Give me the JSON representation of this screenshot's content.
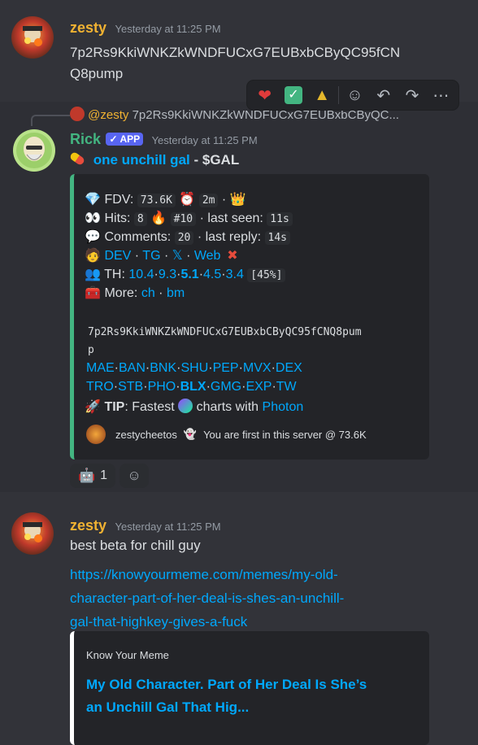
{
  "msg1": {
    "author": "zesty",
    "timestamp": "Yesterday at 11:25 PM",
    "text_line1": "7p2Rs9KkiWNKZkWNDFUCxG7EUBxbCByQC95fCN",
    "text_line2": "Q8pump"
  },
  "reply": {
    "author": "@zesty",
    "preview": "7p2Rs9KkiWNKZkWNDFUCxG7EUBxbCByQC..."
  },
  "msg2": {
    "author": "Rick",
    "badge": "APP",
    "timestamp": "Yesterday at 11:25 PM",
    "title_link": "one unchill gal",
    "title_sep": " - ",
    "title_ticker": "$GAL",
    "embed": {
      "fdv_label": "FDV:",
      "fdv_value": "73.6K",
      "age_value": "2m",
      "hits_label": "Hits:",
      "hits_value": "8",
      "rank": "#10",
      "last_seen_label": "· last seen:",
      "last_seen_value": "11s",
      "comments_label": "Comments:",
      "comments_value": "20",
      "last_reply_label": "· last reply:",
      "last_reply_value": "14s",
      "links": [
        "DEV",
        "TG",
        "𝕏",
        "Web"
      ],
      "th_label": "TH:",
      "th_values": [
        "10.4",
        "9.3",
        "5.1",
        "4.5",
        "3.4"
      ],
      "th_pct": "[45%]",
      "more_label": "More:",
      "more_links": [
        "ch",
        "bm"
      ],
      "address_line1": "7p2Rs9KkiWNKZkWNDFUCxG7EUBxbCByQC95fCNQ8pum",
      "address_line2": "p",
      "platforms_row1": [
        "MAE",
        "BAN",
        "BNK",
        "SHU",
        "PEP",
        "MVX",
        "DEX"
      ],
      "platforms_row2": [
        "TRO",
        "STB",
        "PHO",
        "BLX",
        "GMG",
        "EXP",
        "TW"
      ],
      "tip_label": "TIP",
      "tip_text1": ": Fastest",
      "tip_text2": "charts with",
      "tip_link": "Photon",
      "footer_user": "zestycheetos",
      "footer_text": "You are first in this server @ 73.6K"
    },
    "reaction_count": "1"
  },
  "msg3": {
    "author": "zesty",
    "timestamp": "Yesterday at 11:25 PM",
    "text": "best beta for chill guy",
    "url_line1": "https://knowyourmeme.com/memes/my-old-",
    "url_line2": "character-part-of-her-deal-is-shes-an-unchill-",
    "url_line3": "gal-that-highkey-gives-a-fuck",
    "embed_provider": "Know Your Meme",
    "embed_title_line1": "My Old Character. Part of Her Deal Is She’s",
    "embed_title_line2": "an Unchill Gal That Hig..."
  },
  "colors": {
    "background": "#323339",
    "hover_bg": "#2e2f35",
    "username_zesty": "#f0b232",
    "username_rick": "#43b581",
    "link": "#00a8fc",
    "embed_border": "#43b581",
    "app_badge": "#5865f2"
  },
  "icons": [
    "heart-icon",
    "check-icon",
    "arrow-logo-icon",
    "add-reaction-icon",
    "reply-icon",
    "forward-icon",
    "more-icon"
  ]
}
